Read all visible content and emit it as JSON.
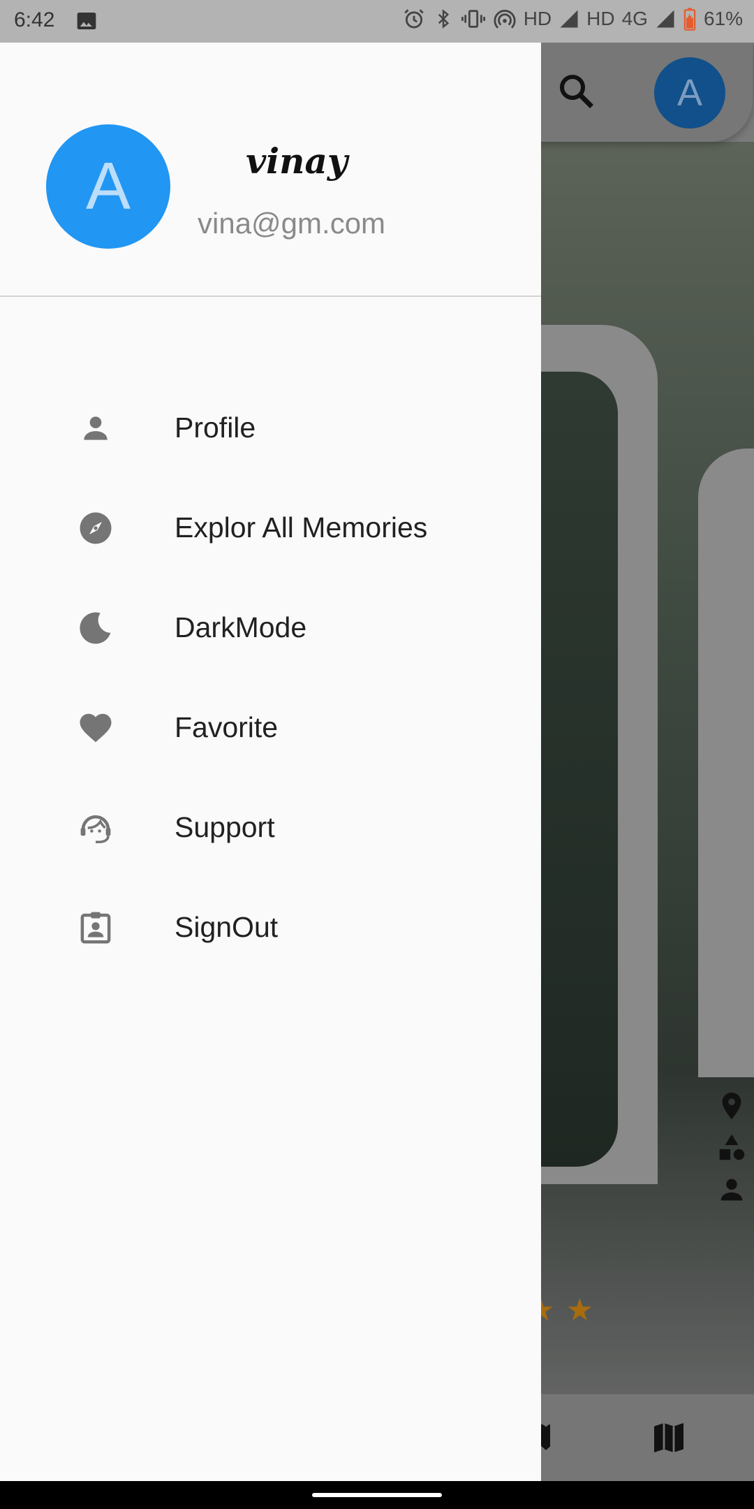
{
  "status_bar": {
    "time": "6:42",
    "icons": [
      "image-icon",
      "alarm-icon",
      "bluetooth-icon",
      "vibrate-icon",
      "hotspot-icon",
      "signal-icon",
      "signal-icon",
      "battery-icon"
    ],
    "network_1": "HD",
    "network_2": "HD",
    "network_type": "4G",
    "battery": "61%",
    "battery_color": "#e65c2e"
  },
  "drawer": {
    "avatar_letter": "A",
    "avatar_color": "#2196f3",
    "username": "vinay",
    "email": "vina@gm.com",
    "items": [
      {
        "label": "Profile",
        "icon": "person-icon"
      },
      {
        "label": "Explor All Memories",
        "icon": "compass-icon"
      },
      {
        "label": "DarkMode",
        "icon": "moon-icon"
      },
      {
        "label": "Favorite",
        "icon": "heart-icon"
      },
      {
        "label": "Support",
        "icon": "support-agent-icon"
      },
      {
        "label": "SignOut",
        "icon": "badge-icon"
      }
    ]
  },
  "background_app": {
    "avatar_letter": "A",
    "rating_stars": "★ ★"
  }
}
